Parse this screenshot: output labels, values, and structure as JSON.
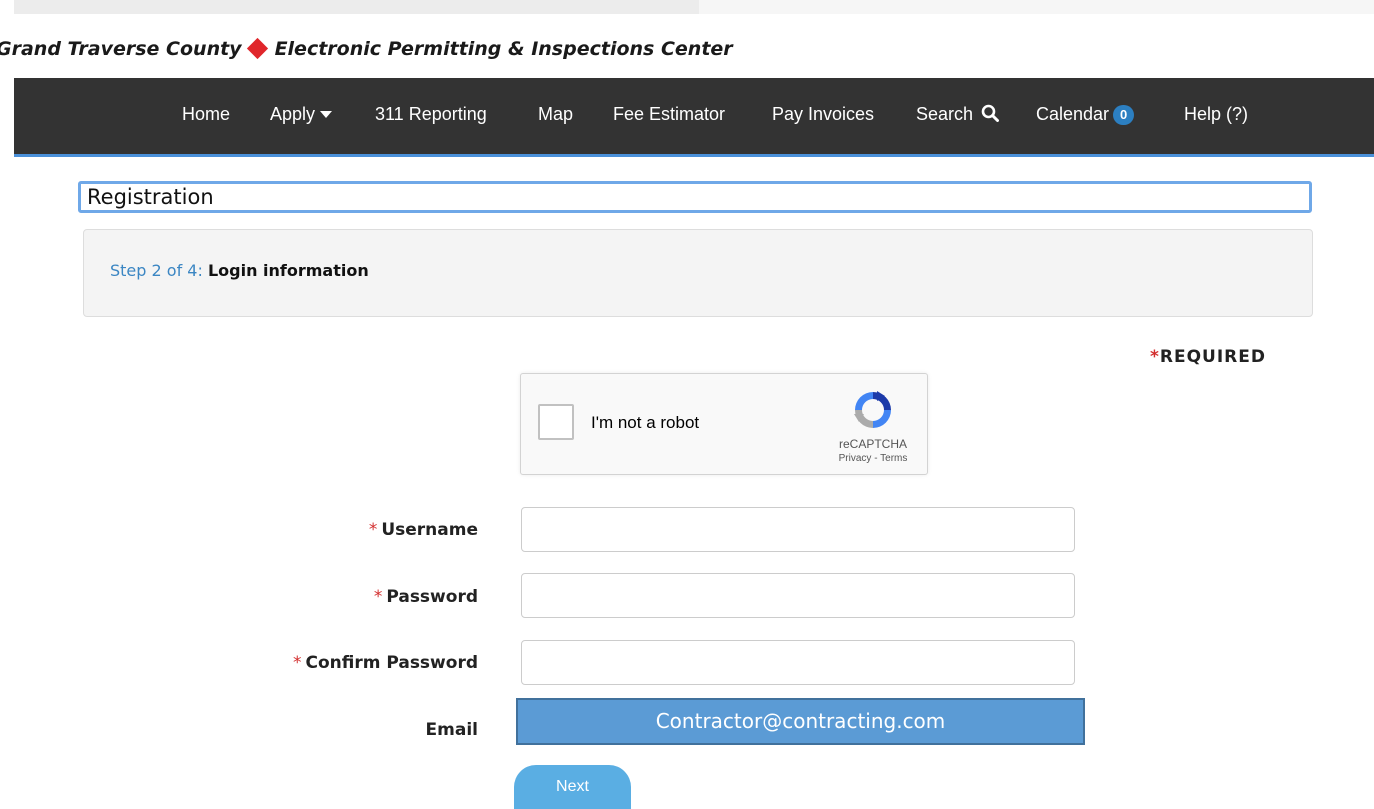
{
  "site": {
    "title_left": "Grand Traverse County",
    "title_right": "Electronic Permitting & Inspections Center"
  },
  "nav": {
    "home": "Home",
    "apply": "Apply",
    "reporting": "311 Reporting",
    "map": "Map",
    "fee_estimator": "Fee Estimator",
    "pay_invoices": "Pay Invoices",
    "search": "Search",
    "calendar": "Calendar",
    "calendar_count": "0",
    "help": "Help (?)"
  },
  "page": {
    "heading": "Registration",
    "step_prefix": "Step 2 of 4:",
    "step_name": "Login information",
    "required_star": "*",
    "required_label": "REQUIRED"
  },
  "captcha": {
    "label": "I'm not a robot",
    "brand": "reCAPTCHA",
    "links": "Privacy - Terms"
  },
  "form": {
    "required_star": "*",
    "username_label": "Username",
    "username_value": "",
    "password_label": "Password",
    "password_value": "",
    "confirm_label": "Confirm Password",
    "confirm_value": "",
    "email_label": "Email",
    "email_value": "Contractor@contracting.com",
    "next_label": "Next"
  },
  "colors": {
    "navbar": "#333333",
    "accent_blue": "#4a90d9",
    "step_blue": "#3b86c3",
    "required_red": "#d32f2f",
    "diamond_red": "#e0262b",
    "email_box": "#5b9bd5",
    "next_button": "#5aaee3"
  },
  "icons": {
    "diamond": "red-diamond-icon",
    "apply_caret": "caret-down-icon",
    "search": "search-icon",
    "captcha_logo": "recaptcha-logo-icon"
  }
}
